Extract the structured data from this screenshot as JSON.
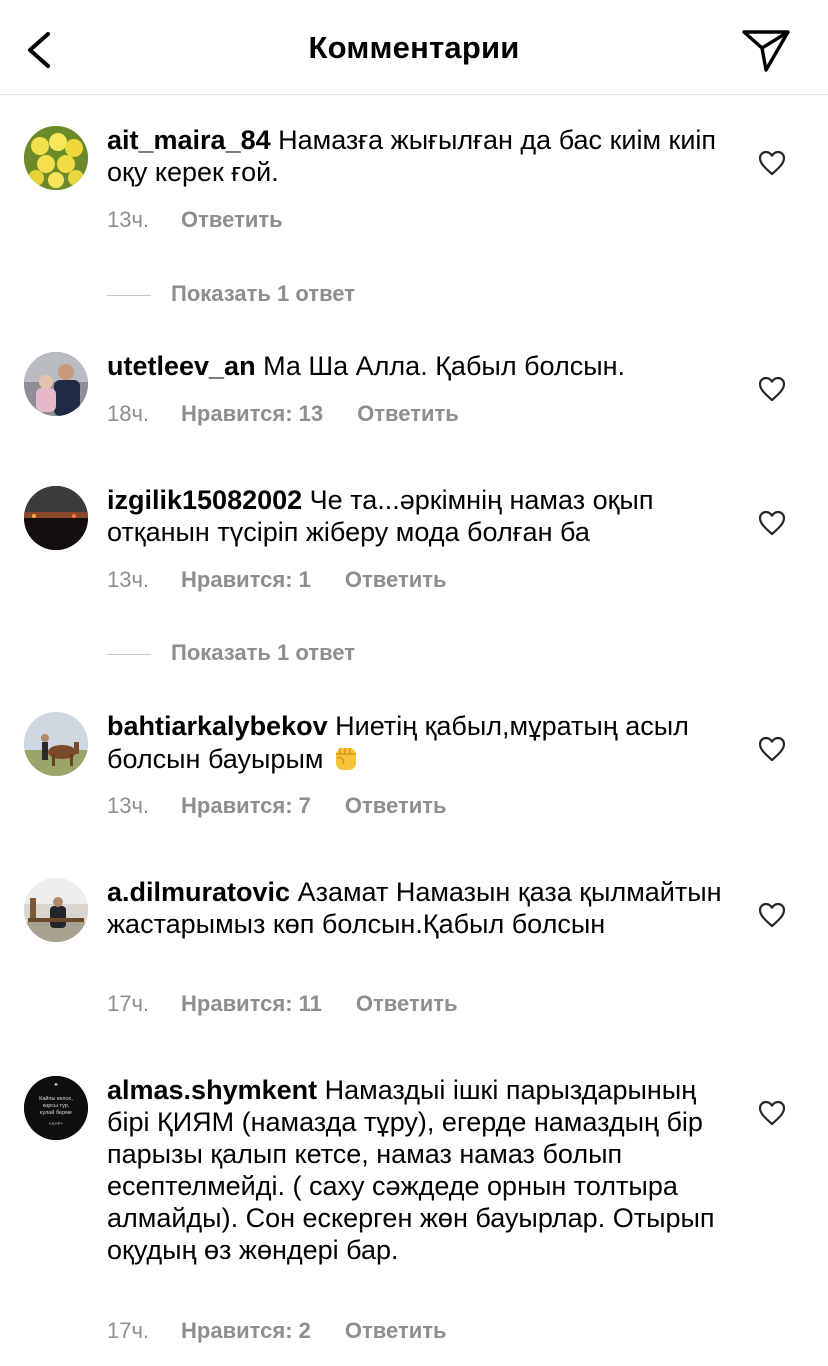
{
  "header": {
    "title": "Комментарии",
    "back_icon": "chevron-left-icon",
    "send_icon": "paper-plane-icon"
  },
  "comments": [
    {
      "username": "ait_maira_84",
      "text": "Намазға жығылған да бас киім киіп оқу керек ғой.",
      "time": "13ч.",
      "reply": "Ответить",
      "show_replies": "Показать 1 ответ"
    },
    {
      "username": "utetleev_an",
      "text": "Ма Ша Алла. Қабыл болсын.",
      "time": "18ч.",
      "likes": "Нравится: 13",
      "reply": "Ответить"
    },
    {
      "username": "izgilik15082002",
      "text": "Че та...әркімнің намаз оқып отқанын түсіріп жіберу мода болған ба",
      "time": "13ч.",
      "likes": "Нравится: 1",
      "reply": "Ответить",
      "show_replies": "Показать 1 ответ"
    },
    {
      "username": "bahtiarkalybekov",
      "text": "Ниетің қабыл,мұратың асыл болсын бауырым",
      "emoji": "raised-fist-emoji",
      "time": "13ч.",
      "likes": "Нравится: 7",
      "reply": "Ответить"
    },
    {
      "username": "a.dilmuratovic",
      "text": "Азамат Намазын қаза қылмайтын жастарымыз көп болсын.Қабыл болсын",
      "time": "17ч.",
      "likes": "Нравится: 11",
      "reply": "Ответить"
    },
    {
      "username": "almas.shymkent",
      "text": "Намаздыі ішкі парыздарының бірі ҚИЯМ (намазда тұру), егерде намаздың бір парызы қалып кетсе, намаз намаз болып есептелмейді. ( саху сәждеде орнын толтыра алмайды). Сон ескерген жөн бауырлар. Отырып оқудың өз жөндері бар.",
      "time": "17ч.",
      "likes": "Нравится: 2",
      "reply": "Ответить",
      "avatar_text": [
        "Кайпы келсе,",
        "карсы тур,",
        "кулай берме",
        "АХАР+"
      ]
    }
  ],
  "icons": {
    "like": "heart-outline-icon"
  }
}
